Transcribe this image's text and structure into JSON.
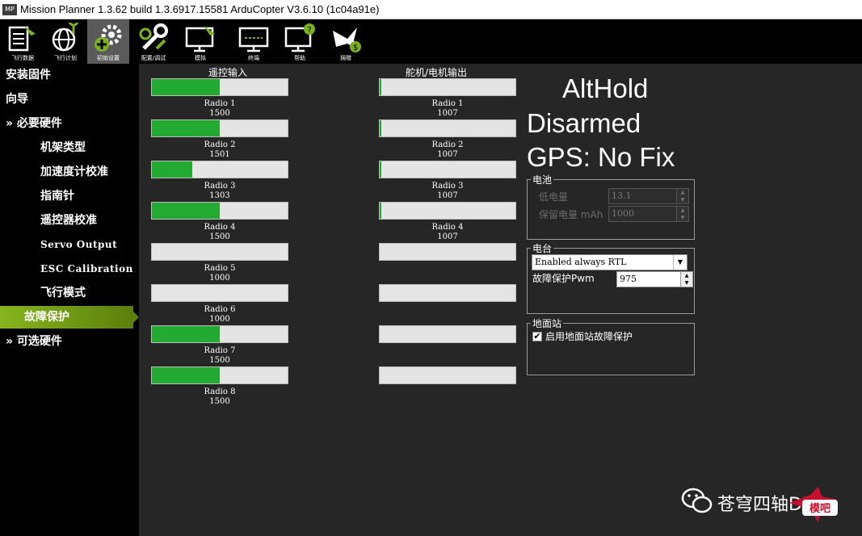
{
  "window": {
    "title": "Mission Planner 1.3.62 build 1.3.6917.15581 ArduCopter V3.6.10 (1c04a91e)",
    "app_icon_text": "MP"
  },
  "toolbar": {
    "items": [
      {
        "label": "飞行数据",
        "icon": "flight-data-icon"
      },
      {
        "label": "飞行计划",
        "icon": "flight-plan-icon"
      },
      {
        "label": "初始设置",
        "icon": "initial-setup-icon",
        "active": true
      },
      {
        "label": "配置/调试",
        "icon": "config-tuning-icon"
      },
      {
        "label": "模拟",
        "icon": "simulation-icon"
      },
      {
        "label": "终端",
        "icon": "terminal-icon"
      },
      {
        "label": "帮助",
        "icon": "help-icon"
      },
      {
        "label": "捐赠",
        "icon": "donate-icon"
      }
    ]
  },
  "sidebar": {
    "items": [
      {
        "label": "安装固件"
      },
      {
        "label": "向导"
      },
      {
        "label": "» 必要硬件"
      },
      {
        "label": "机架类型"
      },
      {
        "label": "加速度计校准"
      },
      {
        "label": "指南针"
      },
      {
        "label": "遥控器校准"
      },
      {
        "label": "Servo Output"
      },
      {
        "label": "ESC Calibration"
      },
      {
        "label": "飞行模式"
      },
      {
        "label": "故障保护",
        "active": true
      },
      {
        "label": "» 可选硬件"
      }
    ]
  },
  "radio_input": {
    "title": "遥控输入",
    "channels": [
      {
        "name": "Radio 1",
        "value": "1500",
        "fill": 0.5
      },
      {
        "name": "Radio 2",
        "value": "1501",
        "fill": 0.5
      },
      {
        "name": "Radio 3",
        "value": "1303",
        "fill": 0.3
      },
      {
        "name": "Radio 4",
        "value": "1500",
        "fill": 0.5
      },
      {
        "name": "Radio 5",
        "value": "1000",
        "fill": 0.0
      },
      {
        "name": "Radio 6",
        "value": "1000",
        "fill": 0.0
      },
      {
        "name": "Radio 7",
        "value": "1500",
        "fill": 0.5
      },
      {
        "name": "Radio 8",
        "value": "1500",
        "fill": 0.5
      }
    ]
  },
  "servo_output": {
    "title": "舵机/电机输出",
    "channels": [
      {
        "name": "Radio 1",
        "value": "1007",
        "fill": 0.01
      },
      {
        "name": "Radio 2",
        "value": "1007",
        "fill": 0.01
      },
      {
        "name": "Radio 3",
        "value": "1007",
        "fill": 0.01
      },
      {
        "name": "Radio 4",
        "value": "1007",
        "fill": 0.01
      },
      {
        "name": "",
        "value": "",
        "fill": 0.0
      },
      {
        "name": "",
        "value": "",
        "fill": 0.0
      },
      {
        "name": "",
        "value": "",
        "fill": 0.0
      },
      {
        "name": "",
        "value": "",
        "fill": 0.0
      }
    ]
  },
  "status": {
    "mode": "AltHold",
    "armed": "Disarmed",
    "gps": "GPS: No Fix"
  },
  "battery": {
    "title": "电池",
    "low_voltage_label": "低电量",
    "low_voltage_value": "13.1",
    "reserved_mah_label": "保留电量 mAh",
    "reserved_mah_value": "1000"
  },
  "radio": {
    "title": "电台",
    "action_value": "Enabled always RTL",
    "pwm_label": "故障保护Pwm",
    "pwm_value": "975"
  },
  "gcs": {
    "title": "地面站",
    "checkbox_label": "启用地面站故障保护",
    "checked": true
  },
  "watermark": {
    "text": "苍穹四轴DIY",
    "logo_text": "模吧"
  },
  "colors": {
    "accent_green": "#22aa33",
    "sidebar_active": "#86b51e"
  }
}
